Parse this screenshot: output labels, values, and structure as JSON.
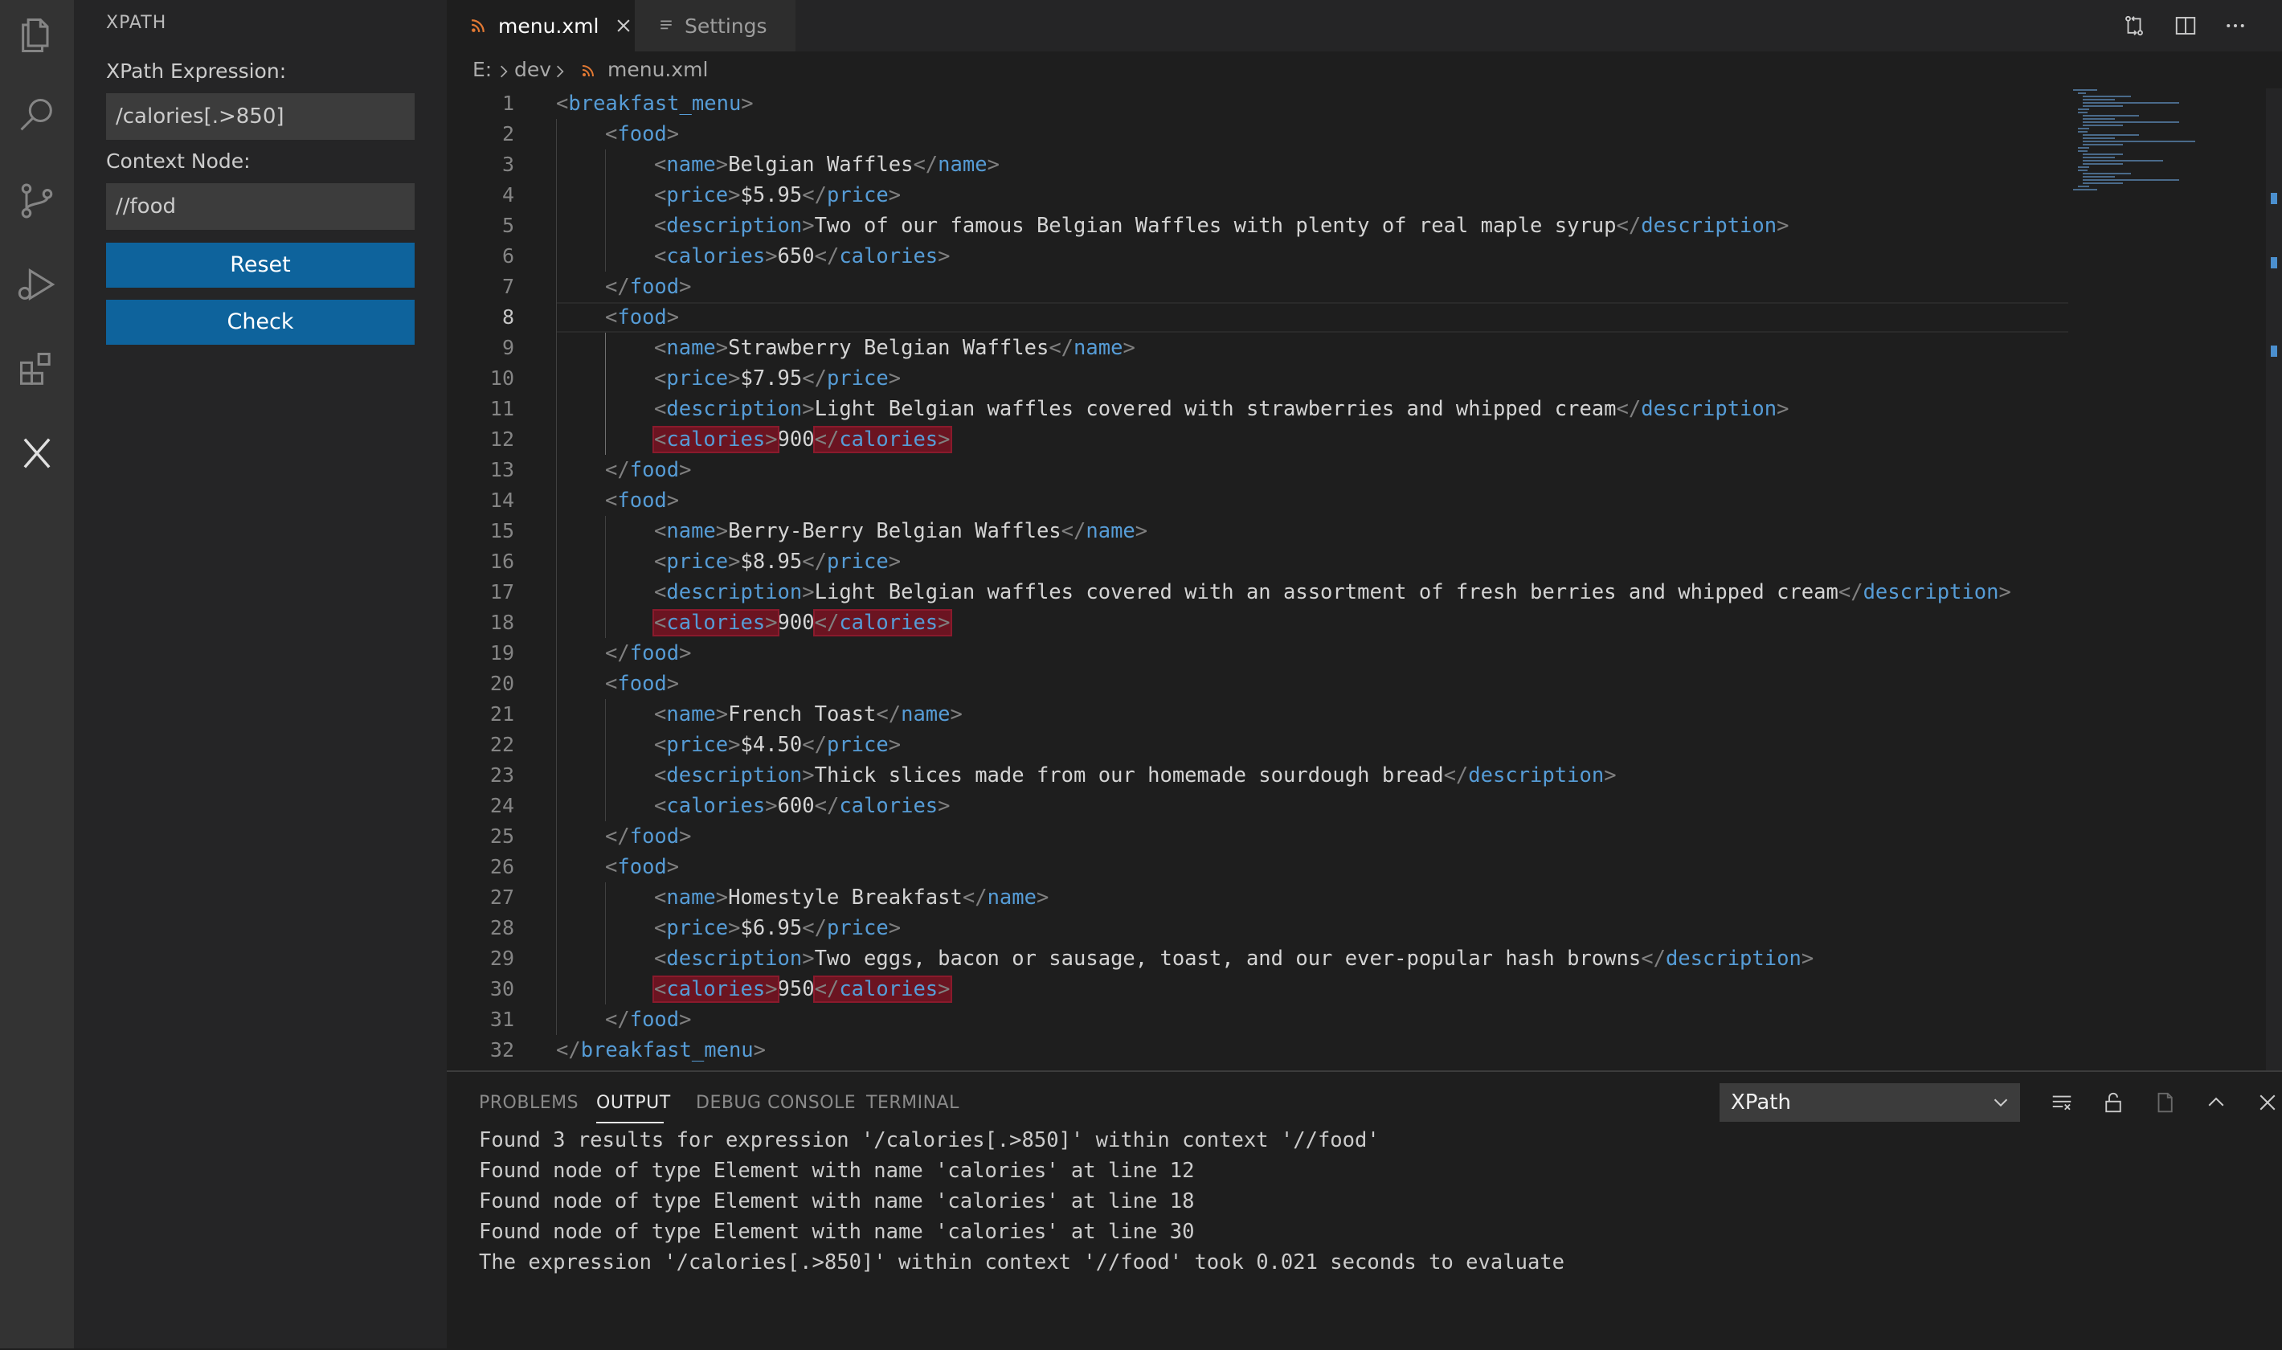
{
  "side_panel": {
    "title": "XPATH",
    "expression_label": "XPath Expression:",
    "expression_value": "/calories[.>850]",
    "context_label": "Context Node:",
    "context_value": "//food",
    "reset_label": "Reset",
    "check_label": "Check"
  },
  "activity_bar": {
    "icons": [
      "files-icon",
      "search-icon",
      "source-control-icon",
      "run-debug-icon",
      "extensions-icon",
      "xpath-icon"
    ]
  },
  "tabs": [
    {
      "label": "menu.xml",
      "active": true
    },
    {
      "label": "Settings",
      "active": false
    }
  ],
  "breadcrumb": [
    "E:",
    "dev",
    "menu.xml"
  ],
  "editor": {
    "active_line": 8,
    "lines": [
      [
        [
          "br",
          "<"
        ],
        [
          "tag",
          "breakfast_menu"
        ],
        [
          "br",
          ">"
        ]
      ],
      [
        [
          "ind",
          1
        ],
        [
          "br",
          "<"
        ],
        [
          "tag",
          "food"
        ],
        [
          "br",
          ">"
        ]
      ],
      [
        [
          "ind",
          2
        ],
        [
          "br",
          "<"
        ],
        [
          "tag",
          "name"
        ],
        [
          "br",
          ">"
        ],
        [
          "txt",
          "Belgian Waffles"
        ],
        [
          "br",
          "</"
        ],
        [
          "tag",
          "name"
        ],
        [
          "br",
          ">"
        ]
      ],
      [
        [
          "ind",
          2
        ],
        [
          "br",
          "<"
        ],
        [
          "tag",
          "price"
        ],
        [
          "br",
          ">"
        ],
        [
          "txt",
          "$5.95"
        ],
        [
          "br",
          "</"
        ],
        [
          "tag",
          "price"
        ],
        [
          "br",
          ">"
        ]
      ],
      [
        [
          "ind",
          2
        ],
        [
          "br",
          "<"
        ],
        [
          "tag",
          "description"
        ],
        [
          "br",
          ">"
        ],
        [
          "txt",
          "Two of our famous Belgian Waffles with plenty of real maple syrup"
        ],
        [
          "br",
          "</"
        ],
        [
          "tag",
          "description"
        ],
        [
          "br",
          ">"
        ]
      ],
      [
        [
          "ind",
          2
        ],
        [
          "br",
          "<"
        ],
        [
          "tag",
          "calories"
        ],
        [
          "br",
          ">"
        ],
        [
          "txt",
          "650"
        ],
        [
          "br",
          "</"
        ],
        [
          "tag",
          "calories"
        ],
        [
          "br",
          ">"
        ]
      ],
      [
        [
          "ind",
          1
        ],
        [
          "br",
          "</"
        ],
        [
          "tag",
          "food"
        ],
        [
          "br",
          ">"
        ]
      ],
      [
        [
          "ind",
          1
        ],
        [
          "br",
          "<"
        ],
        [
          "tag",
          "food"
        ],
        [
          "br",
          ">"
        ]
      ],
      [
        [
          "ind",
          2
        ],
        [
          "br",
          "<"
        ],
        [
          "tag",
          "name"
        ],
        [
          "br",
          ">"
        ],
        [
          "txt",
          "Strawberry Belgian Waffles"
        ],
        [
          "br",
          "</"
        ],
        [
          "tag",
          "name"
        ],
        [
          "br",
          ">"
        ]
      ],
      [
        [
          "ind",
          2
        ],
        [
          "br",
          "<"
        ],
        [
          "tag",
          "price"
        ],
        [
          "br",
          ">"
        ],
        [
          "txt",
          "$7.95"
        ],
        [
          "br",
          "</"
        ],
        [
          "tag",
          "price"
        ],
        [
          "br",
          ">"
        ]
      ],
      [
        [
          "ind",
          2
        ],
        [
          "br",
          "<"
        ],
        [
          "tag",
          "description"
        ],
        [
          "br",
          ">"
        ],
        [
          "txt",
          "Light Belgian waffles covered with strawberries and whipped cream"
        ],
        [
          "br",
          "</"
        ],
        [
          "tag",
          "description"
        ],
        [
          "br",
          ">"
        ]
      ],
      [
        [
          "ind",
          2
        ],
        [
          "hlo",
          "<calories>"
        ],
        [
          "txt",
          "900"
        ],
        [
          "hlc",
          "</calories>"
        ]
      ],
      [
        [
          "ind",
          1
        ],
        [
          "br",
          "</"
        ],
        [
          "tag",
          "food"
        ],
        [
          "br",
          ">"
        ]
      ],
      [
        [
          "ind",
          1
        ],
        [
          "br",
          "<"
        ],
        [
          "tag",
          "food"
        ],
        [
          "br",
          ">"
        ]
      ],
      [
        [
          "ind",
          2
        ],
        [
          "br",
          "<"
        ],
        [
          "tag",
          "name"
        ],
        [
          "br",
          ">"
        ],
        [
          "txt",
          "Berry-Berry Belgian Waffles"
        ],
        [
          "br",
          "</"
        ],
        [
          "tag",
          "name"
        ],
        [
          "br",
          ">"
        ]
      ],
      [
        [
          "ind",
          2
        ],
        [
          "br",
          "<"
        ],
        [
          "tag",
          "price"
        ],
        [
          "br",
          ">"
        ],
        [
          "txt",
          "$8.95"
        ],
        [
          "br",
          "</"
        ],
        [
          "tag",
          "price"
        ],
        [
          "br",
          ">"
        ]
      ],
      [
        [
          "ind",
          2
        ],
        [
          "br",
          "<"
        ],
        [
          "tag",
          "description"
        ],
        [
          "br",
          ">"
        ],
        [
          "txt",
          "Light Belgian waffles covered with an assortment of fresh berries and whipped cream"
        ],
        [
          "br",
          "</"
        ],
        [
          "tag",
          "description"
        ],
        [
          "br",
          ">"
        ]
      ],
      [
        [
          "ind",
          2
        ],
        [
          "hlo",
          "<calories>"
        ],
        [
          "txt",
          "900"
        ],
        [
          "hlc",
          "</calories>"
        ]
      ],
      [
        [
          "ind",
          1
        ],
        [
          "br",
          "</"
        ],
        [
          "tag",
          "food"
        ],
        [
          "br",
          ">"
        ]
      ],
      [
        [
          "ind",
          1
        ],
        [
          "br",
          "<"
        ],
        [
          "tag",
          "food"
        ],
        [
          "br",
          ">"
        ]
      ],
      [
        [
          "ind",
          2
        ],
        [
          "br",
          "<"
        ],
        [
          "tag",
          "name"
        ],
        [
          "br",
          ">"
        ],
        [
          "txt",
          "French Toast"
        ],
        [
          "br",
          "</"
        ],
        [
          "tag",
          "name"
        ],
        [
          "br",
          ">"
        ]
      ],
      [
        [
          "ind",
          2
        ],
        [
          "br",
          "<"
        ],
        [
          "tag",
          "price"
        ],
        [
          "br",
          ">"
        ],
        [
          "txt",
          "$4.50"
        ],
        [
          "br",
          "</"
        ],
        [
          "tag",
          "price"
        ],
        [
          "br",
          ">"
        ]
      ],
      [
        [
          "ind",
          2
        ],
        [
          "br",
          "<"
        ],
        [
          "tag",
          "description"
        ],
        [
          "br",
          ">"
        ],
        [
          "txt",
          "Thick slices made from our homemade sourdough bread"
        ],
        [
          "br",
          "</"
        ],
        [
          "tag",
          "description"
        ],
        [
          "br",
          ">"
        ]
      ],
      [
        [
          "ind",
          2
        ],
        [
          "br",
          "<"
        ],
        [
          "tag",
          "calories"
        ],
        [
          "br",
          ">"
        ],
        [
          "txt",
          "600"
        ],
        [
          "br",
          "</"
        ],
        [
          "tag",
          "calories"
        ],
        [
          "br",
          ">"
        ]
      ],
      [
        [
          "ind",
          1
        ],
        [
          "br",
          "</"
        ],
        [
          "tag",
          "food"
        ],
        [
          "br",
          ">"
        ]
      ],
      [
        [
          "ind",
          1
        ],
        [
          "br",
          "<"
        ],
        [
          "tag",
          "food"
        ],
        [
          "br",
          ">"
        ]
      ],
      [
        [
          "ind",
          2
        ],
        [
          "br",
          "<"
        ],
        [
          "tag",
          "name"
        ],
        [
          "br",
          ">"
        ],
        [
          "txt",
          "Homestyle Breakfast"
        ],
        [
          "br",
          "</"
        ],
        [
          "tag",
          "name"
        ],
        [
          "br",
          ">"
        ]
      ],
      [
        [
          "ind",
          2
        ],
        [
          "br",
          "<"
        ],
        [
          "tag",
          "price"
        ],
        [
          "br",
          ">"
        ],
        [
          "txt",
          "$6.95"
        ],
        [
          "br",
          "</"
        ],
        [
          "tag",
          "price"
        ],
        [
          "br",
          ">"
        ]
      ],
      [
        [
          "ind",
          2
        ],
        [
          "br",
          "<"
        ],
        [
          "tag",
          "description"
        ],
        [
          "br",
          ">"
        ],
        [
          "txt",
          "Two eggs, bacon or sausage, toast, and our ever-popular hash browns"
        ],
        [
          "br",
          "</"
        ],
        [
          "tag",
          "description"
        ],
        [
          "br",
          ">"
        ]
      ],
      [
        [
          "ind",
          2
        ],
        [
          "hlo",
          "<calories>"
        ],
        [
          "txt",
          "950"
        ],
        [
          "hlc",
          "</calories>"
        ]
      ],
      [
        [
          "ind",
          1
        ],
        [
          "br",
          "</"
        ],
        [
          "tag",
          "food"
        ],
        [
          "br",
          ">"
        ]
      ],
      [
        [
          "br",
          "</"
        ],
        [
          "tag",
          "breakfast_menu"
        ],
        [
          "br",
          ">"
        ]
      ]
    ]
  },
  "panel": {
    "tabs": [
      "PROBLEMS",
      "OUTPUT",
      "DEBUG CONSOLE",
      "TERMINAL"
    ],
    "active_tab": "OUTPUT",
    "channel": "XPath",
    "output": [
      "Found 3 results for expression '/calories[.>850]' within context '//food'",
      "Found node of type Element with name 'calories' at line 12",
      "Found node of type Element with name 'calories' at line 18",
      "Found node of type Element with name 'calories' at line 30",
      "The expression '/calories[.>850]' within context '//food' took 0.021 seconds to evaluate"
    ]
  },
  "colors": {
    "accent": "#0e639c",
    "tag": "#569cd6",
    "bracket": "#808080",
    "highlight": "#6b1421"
  }
}
